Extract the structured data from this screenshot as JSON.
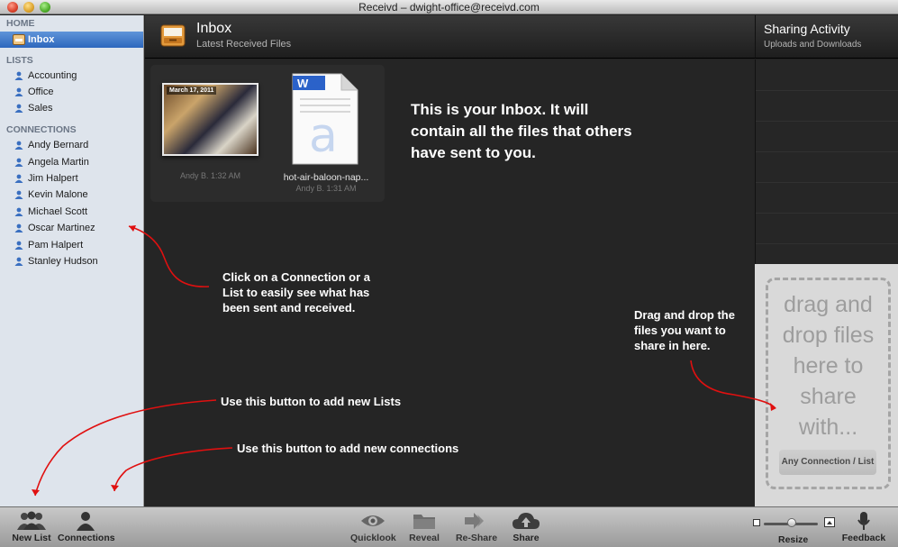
{
  "window": {
    "title": "Receivd – dwight-office@receivd.com"
  },
  "sidebar": {
    "home_heading": "HOME",
    "inbox_label": "Inbox",
    "lists_heading": "LISTS",
    "lists": [
      "Accounting",
      "Office",
      "Sales"
    ],
    "connections_heading": "CONNECTIONS",
    "connections": [
      "Andy Bernard",
      "Angela Martin",
      "Jim Halpert",
      "Kevin Malone",
      "Michael Scott",
      "Oscar Martinez",
      "Pam Halpert",
      "Stanley Hudson"
    ]
  },
  "header": {
    "title": "Inbox",
    "subtitle": "Latest Received Files"
  },
  "files": [
    {
      "date_stamp": "March 17, 2011",
      "meta": "Andy B. 1:32 AM",
      "name": ""
    },
    {
      "name": "hot-air-baloon-nap...",
      "meta": "Andy B. 1:31 AM"
    }
  ],
  "notes": {
    "inbox": "This is your Inbox. It will contain all the files that others have sent to you.",
    "connection": "Click on a Connection or a List to easily see what has been sent and received.",
    "drag": "Drag and drop the files you want to share in here.",
    "new_list": "Use this button to add new Lists",
    "new_connection": "Use this button to add new connections"
  },
  "sharing": {
    "title": "Sharing Activity",
    "subtitle": "Uploads and Downloads"
  },
  "drop_zone": {
    "text": "drag and drop files here to share with...",
    "button": "Any Connection / List"
  },
  "toolbar": {
    "new_list": "New List",
    "connections": "Connections",
    "quicklook": "Quicklook",
    "reveal": "Reveal",
    "reshare": "Re-Share",
    "share": "Share",
    "resize": "Resize",
    "feedback": "Feedback"
  },
  "colors": {
    "annotation_arrow": "#e01010",
    "selection": "#3a74c6",
    "sidebar_bg": "#dee4ec"
  }
}
